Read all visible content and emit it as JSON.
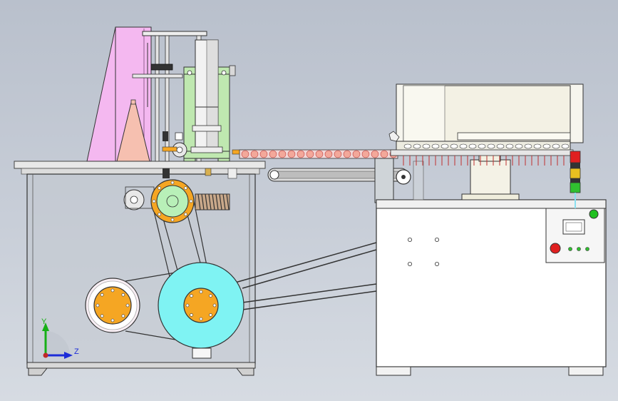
{
  "viewport": {
    "background_top": "#b9c0cc",
    "background_bottom": "#d6dbe2"
  },
  "triad": {
    "y_label": "Y",
    "z_label": "Z",
    "y_color": "#16b016",
    "z_color": "#1c2cd8",
    "origin_color": "#c02828"
  },
  "colors": {
    "hopper": "#f4b8f0",
    "cone": "#f6c0b0",
    "frame_green": "#bfe8b0",
    "pulley_orange": "#f5a623",
    "big_wheel": "#7ff3f3",
    "pulley_green": "#b8f0b8",
    "tray_white": "#f6f5ee",
    "lamp_red": "#e02020",
    "lamp_yellow": "#e8c020",
    "lamp_green": "#30c030",
    "estop": "#e02020",
    "start_btn": "#20c020"
  },
  "icons": [
    "axis-triad-icon"
  ]
}
